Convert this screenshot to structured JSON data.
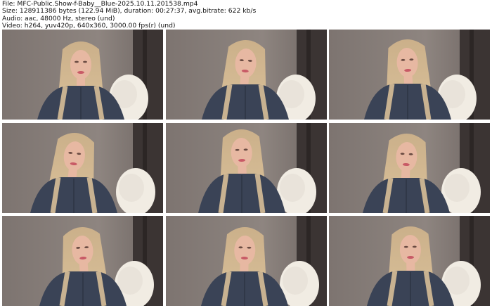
{
  "header": {
    "file_line": "File: MFC-Public.Show-f-Baby__Blue-2025.10.11.201538.mp4",
    "size_line": "Size: 128911386 bytes (122.94 MiB), duration: 00:27:37, avg.bitrate: 622 kb/s",
    "audio_line": "Audio: aac, 48000 Hz, stereo (und)",
    "video_line": "Video: h264, yuv420p, 640x360, 3000.00 fps(r) (und)"
  },
  "thumbnails": [
    {
      "name": "frame-1"
    },
    {
      "name": "frame-2"
    },
    {
      "name": "frame-3"
    },
    {
      "name": "frame-4"
    },
    {
      "name": "frame-5"
    },
    {
      "name": "frame-6"
    },
    {
      "name": "frame-7"
    },
    {
      "name": "frame-8"
    },
    {
      "name": "frame-9"
    }
  ],
  "colors": {
    "wall": "#8e8580",
    "curtain": "#3b3433",
    "hair": "#d8bf98",
    "skin": "#e7b8a2",
    "top": "#3a4356",
    "pillow": "#f1ece3"
  }
}
